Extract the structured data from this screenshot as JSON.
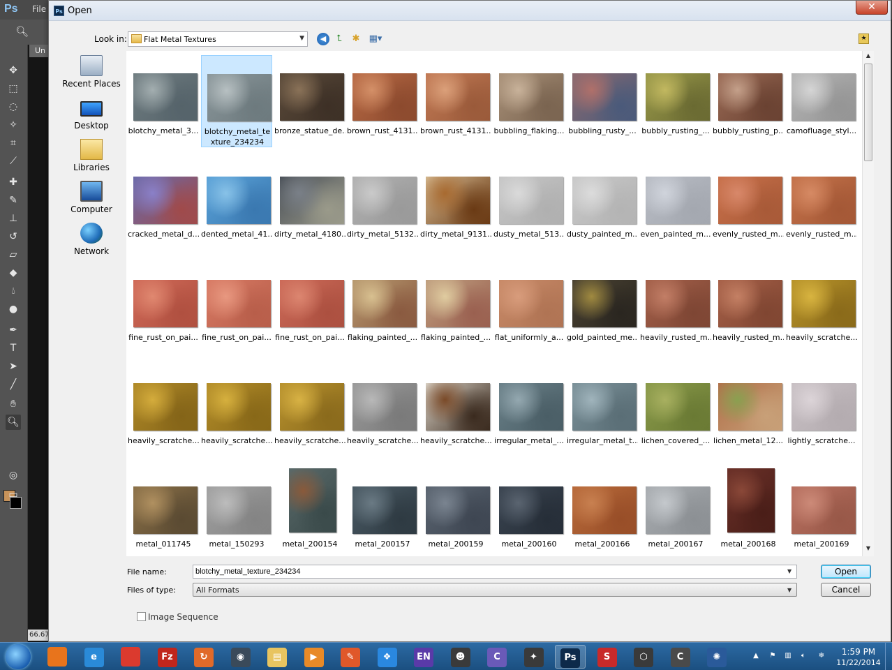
{
  "photoshop": {
    "logo": "Ps",
    "menu_file": "File",
    "doc_tab": "Un",
    "zoom_readout": "66.67",
    "foreground_color": "#c8935a",
    "background_color": "#000000"
  },
  "dialog": {
    "title": "Open",
    "close_glyph": "✕",
    "look_in_label": "Look in:",
    "look_in_value": "Flat Metal Textures",
    "places": [
      {
        "label": "Recent Places",
        "icon": "recent-places-icon"
      },
      {
        "label": "Desktop",
        "icon": "desktop-icon"
      },
      {
        "label": "Libraries",
        "icon": "libraries-icon"
      },
      {
        "label": "Computer",
        "icon": "computer-icon"
      },
      {
        "label": "Network",
        "icon": "network-icon"
      }
    ],
    "files": [
      {
        "name": "blotchy_metal_3...",
        "colors": [
          "#6f7c80",
          "#a3aeb0",
          "#55636a"
        ]
      },
      {
        "name": "blotchy_metal_texture_234234",
        "colors": [
          "#8a969a",
          "#b7c0c2",
          "#6d7a7e"
        ],
        "selected": true
      },
      {
        "name": "bronze_statue_de...",
        "colors": [
          "#5a4a3a",
          "#8a7258",
          "#3d3026"
        ]
      },
      {
        "name": "brown_rust_4131...",
        "colors": [
          "#b86a45",
          "#d49068",
          "#8c4a2e"
        ]
      },
      {
        "name": "brown_rust_4131...",
        "colors": [
          "#c27a55",
          "#dba07a",
          "#9a5a3a"
        ]
      },
      {
        "name": "bubbling_flaking...",
        "colors": [
          "#a89078",
          "#c8b29a",
          "#7a6450"
        ]
      },
      {
        "name": "bubbling_rusty_...",
        "colors": [
          "#8a6a70",
          "#b0706a",
          "#4a5a7a"
        ]
      },
      {
        "name": "bubbly_rusting_...",
        "colors": [
          "#9a9a4a",
          "#c2b860",
          "#6a6a32"
        ]
      },
      {
        "name": "bubbly_rusting_p...",
        "colors": [
          "#9a6a55",
          "#c4a08a",
          "#6a4232"
        ]
      },
      {
        "name": "camofluage_styl...",
        "colors": [
          "#b5b5b5",
          "#d5d5d5",
          "#959595"
        ]
      },
      {
        "name": "cracked_metal_d...",
        "colors": [
          "#6a6aa8",
          "#8a80c8",
          "#a04a4a"
        ]
      },
      {
        "name": "dented_metal_41...",
        "colors": [
          "#5aa2d8",
          "#88c2e8",
          "#3a78b0"
        ]
      },
      {
        "name": "dirty_metal_4180...",
        "colors": [
          "#4a5058",
          "#7a8088",
          "#9a9a8a"
        ]
      },
      {
        "name": "dirty_metal_5132...",
        "colors": [
          "#b0b0b0",
          "#cacaca",
          "#9a9a9a"
        ]
      },
      {
        "name": "dirty_metal_9131...",
        "colors": [
          "#d4b890",
          "#a86a30",
          "#6a3a14"
        ]
      },
      {
        "name": "dusty_metal_513...",
        "colors": [
          "#c6c6c6",
          "#dadada",
          "#b0b0b0"
        ]
      },
      {
        "name": "dusty_painted_m...",
        "colors": [
          "#c8c8c8",
          "#dcdcdc",
          "#b4b4b4"
        ]
      },
      {
        "name": "even_painted_m...",
        "colors": [
          "#b8bcc4",
          "#d0d4dc",
          "#a4a8b0"
        ]
      },
      {
        "name": "evenly_rusted_m...",
        "colors": [
          "#c8704a",
          "#d8886a",
          "#a85a38"
        ]
      },
      {
        "name": "evenly_rusted_m...",
        "colors": [
          "#c4724a",
          "#d68a64",
          "#a45836"
        ]
      },
      {
        "name": "fine_rust_on_pai...",
        "colors": [
          "#d06a58",
          "#e08870",
          "#b05040"
        ]
      },
      {
        "name": "fine_rust_on_pai...",
        "colors": [
          "#d87a64",
          "#e89880",
          "#b85e4a"
        ]
      },
      {
        "name": "fine_rust_on_pai...",
        "colors": [
          "#cc6a58",
          "#dc8670",
          "#ac5040"
        ]
      },
      {
        "name": "flaking_painted_...",
        "colors": [
          "#b89a70",
          "#d8c090",
          "#8a5a40"
        ]
      },
      {
        "name": "flaking_painted_...",
        "colors": [
          "#c0a080",
          "#e0cca0",
          "#9a6050"
        ]
      },
      {
        "name": "flat_uniformly_a...",
        "colors": [
          "#c88a68",
          "#d89c7c",
          "#b07454"
        ]
      },
      {
        "name": "gold_painted_me...",
        "colors": [
          "#4a4232",
          "#a08a40",
          "#2a2620"
        ]
      },
      {
        "name": "heavily_rusted_m...",
        "colors": [
          "#a4604a",
          "#c27e66",
          "#7e4634"
        ]
      },
      {
        "name": "heavily_rusted_m...",
        "colors": [
          "#a66048",
          "#c48064",
          "#804632"
        ]
      },
      {
        "name": "heavily_scratche...",
        "colors": [
          "#b8942a",
          "#d8b440",
          "#8a6a1a"
        ]
      },
      {
        "name": "heavily_scratche...",
        "colors": [
          "#b08a28",
          "#d4ac3c",
          "#846418"
        ]
      },
      {
        "name": "heavily_scratche...",
        "colors": [
          "#b48e2a",
          "#d6b03e",
          "#886818"
        ]
      },
      {
        "name": "heavily_scratche...",
        "colors": [
          "#b8922e",
          "#d8b244",
          "#8a6a1c"
        ]
      },
      {
        "name": "heavily_scratche...",
        "colors": [
          "#9a9a9a",
          "#b8b8b8",
          "#7a7a7a"
        ]
      },
      {
        "name": "heavily_scratche...",
        "colors": [
          "#d8d0c4",
          "#7a4a28",
          "#3a2a1e"
        ]
      },
      {
        "name": "irregular_metal_...",
        "colors": [
          "#6a8088",
          "#94a8b0",
          "#4a5e66"
        ]
      },
      {
        "name": "irregular_metal_t...",
        "colors": [
          "#7a9098",
          "#a0b4bc",
          "#5a6e76"
        ]
      },
      {
        "name": "lichen_covered_...",
        "colors": [
          "#8a9a4a",
          "#a8b060",
          "#6a7a34"
        ]
      },
      {
        "name": "lichen_metal_12...",
        "colors": [
          "#b0704a",
          "#8aa050",
          "#c8a078"
        ]
      },
      {
        "name": "lightly_scratche...",
        "colors": [
          "#c8c0c4",
          "#dcd4d8",
          "#b4acb0"
        ]
      },
      {
        "name": "metal_011745",
        "colors": [
          "#8a7048",
          "#b09060",
          "#5a4a32"
        ]
      },
      {
        "name": "metal_150293",
        "colors": [
          "#a0a0a0",
          "#bcbcbc",
          "#848484"
        ]
      },
      {
        "name": "metal_200154",
        "colors": [
          "#5a6a6a",
          "#8a5a3a",
          "#3a4a4a"
        ],
        "tall": true
      },
      {
        "name": "metal_200157",
        "colors": [
          "#4a5a64",
          "#6a7a84",
          "#2e3a42"
        ]
      },
      {
        "name": "metal_200159",
        "colors": [
          "#5a6470",
          "#7a8490",
          "#3e4652"
        ]
      },
      {
        "name": "metal_200160",
        "colors": [
          "#3a4450",
          "#5a6470",
          "#262e38"
        ]
      },
      {
        "name": "metal_200166",
        "colors": [
          "#b86a3a",
          "#c88050",
          "#984e28"
        ]
      },
      {
        "name": "metal_200167",
        "colors": [
          "#a8acb0",
          "#c4c8cc",
          "#8c9094"
        ]
      },
      {
        "name": "metal_200168",
        "colors": [
          "#6a3028",
          "#8a4838",
          "#4a1e18"
        ],
        "tall": true
      },
      {
        "name": "metal_200169",
        "colors": [
          "#b87060",
          "#cc8a78",
          "#985848"
        ]
      }
    ],
    "file_name_label": "File name:",
    "file_name_value": "blotchy_metal_texture_234234",
    "files_of_type_label": "Files of type:",
    "files_of_type_value": "All Formats",
    "open_button": "Open",
    "cancel_button": "Cancel",
    "image_sequence_label": "Image Sequence"
  },
  "taskbar": {
    "apps": [
      {
        "name": "firefox",
        "glyph": "",
        "color": "#e8741c"
      },
      {
        "name": "internet-explorer",
        "glyph": "e",
        "color": "#2a8ad8"
      },
      {
        "name": "chrome",
        "glyph": "",
        "color": "#db3a2e"
      },
      {
        "name": "filezilla",
        "glyph": "Fz",
        "color": "#c0261c"
      },
      {
        "name": "app-refresh",
        "glyph": "↻",
        "color": "#e06a2a"
      },
      {
        "name": "app-dark",
        "glyph": "◉",
        "color": "#3a4a5a"
      },
      {
        "name": "explorer",
        "glyph": "▤",
        "color": "#e8c460"
      },
      {
        "name": "media-player",
        "glyph": "▶",
        "color": "#e88a28"
      },
      {
        "name": "app-brush",
        "glyph": "✎",
        "color": "#e0582a"
      },
      {
        "name": "dropbox",
        "glyph": "❖",
        "color": "#2a88e0"
      },
      {
        "name": "app-purple",
        "glyph": "EN",
        "color": "#5a3aa8"
      },
      {
        "name": "app-monkey",
        "glyph": "☻",
        "color": "#3a3a3a"
      },
      {
        "name": "app-c-purple",
        "glyph": "C",
        "color": "#6a5ab8"
      },
      {
        "name": "zbrush",
        "glyph": "✦",
        "color": "#3a3a3a"
      },
      {
        "name": "photoshop",
        "glyph": "Ps",
        "color": "#0d2a4a",
        "active": true
      },
      {
        "name": "substance",
        "glyph": "S",
        "color": "#c82a2a"
      },
      {
        "name": "app-hex",
        "glyph": "⬡",
        "color": "#3a3a3a"
      },
      {
        "name": "app-c-grey",
        "glyph": "C",
        "color": "#4a4a4a"
      },
      {
        "name": "app-aperture",
        "glyph": "✺",
        "color": "#2a5a9a"
      }
    ],
    "time": "1:59 PM",
    "date": "11/22/2014"
  }
}
